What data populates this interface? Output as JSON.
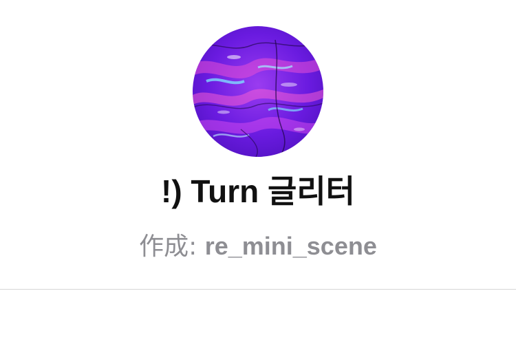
{
  "profile": {
    "title": "!) Turn 글리터",
    "author_prefix": "作成: ",
    "author_name": "re_mini_scene",
    "avatar_icon": "purple-water-ripple-avatar"
  },
  "colors": {
    "title": "#111111",
    "subtitle": "#8e8e93",
    "divider": "#d6d6d6",
    "avatar_primary": "#6a1be0",
    "avatar_accent": "#ff5fd2",
    "avatar_highlight": "#7fe8ff"
  }
}
